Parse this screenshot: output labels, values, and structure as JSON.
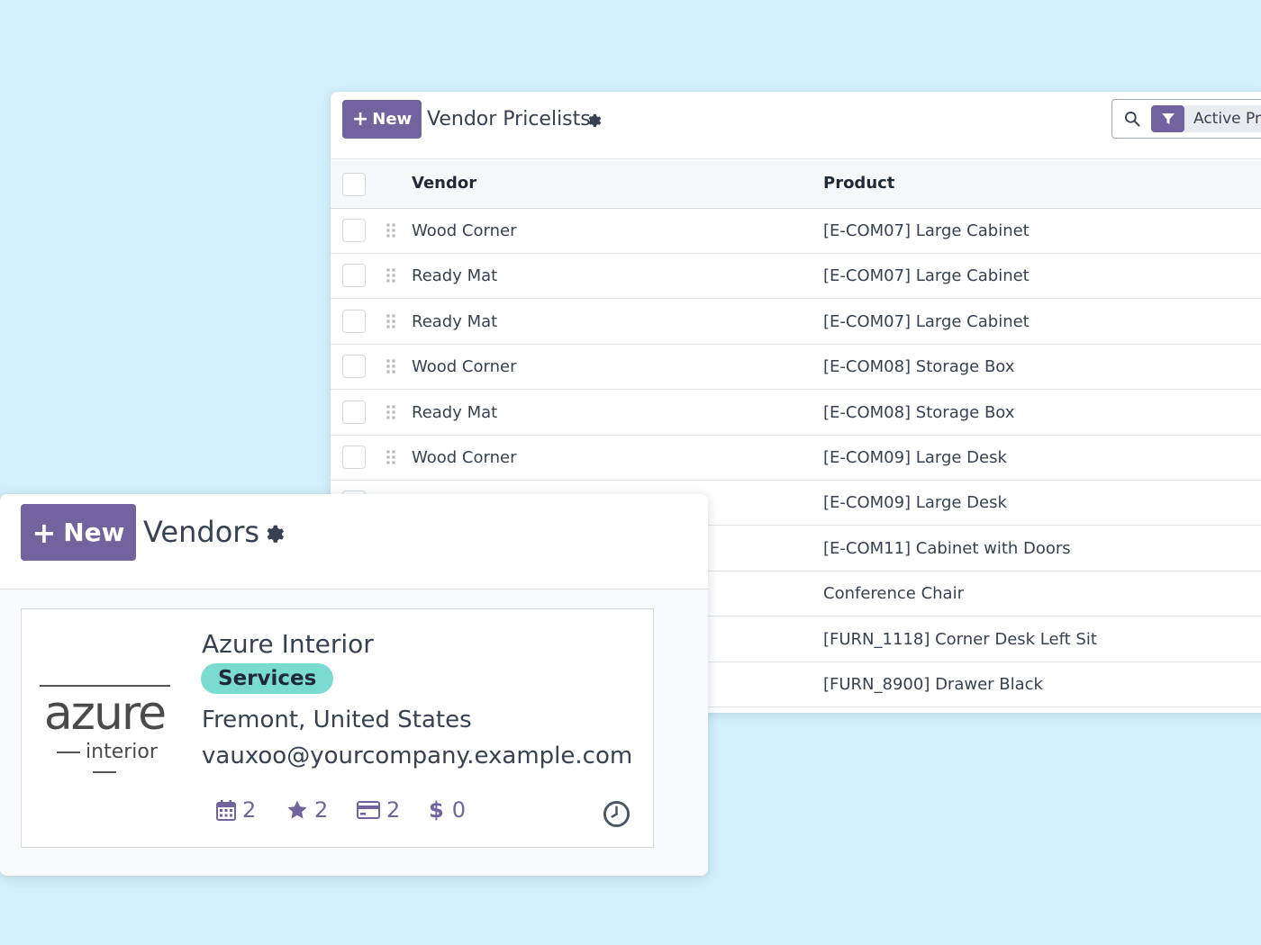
{
  "pricelist": {
    "new_label": "New",
    "title": "Vendor Pricelists",
    "facet": "Active Products",
    "columns": {
      "vendor": "Vendor",
      "product": "Product"
    },
    "rows": [
      {
        "vendor": "Wood Corner",
        "product": "[E-COM07] Large Cabinet"
      },
      {
        "vendor": "Ready Mat",
        "product": "[E-COM07] Large Cabinet"
      },
      {
        "vendor": "Ready Mat",
        "product": "[E-COM07] Large Cabinet"
      },
      {
        "vendor": "Wood Corner",
        "product": "[E-COM08] Storage Box"
      },
      {
        "vendor": "Ready Mat",
        "product": "[E-COM08] Storage Box"
      },
      {
        "vendor": "Wood Corner",
        "product": "[E-COM09] Large Desk"
      },
      {
        "vendor": "",
        "product": "[E-COM09] Large Desk"
      },
      {
        "vendor": "",
        "product": "[E-COM11] Cabinet with Doors"
      },
      {
        "vendor": "",
        "product": "Conference Chair"
      },
      {
        "vendor": "",
        "product": "[FURN_1118] Corner Desk Left Sit"
      },
      {
        "vendor": "",
        "product": "[FURN_8900] Drawer Black"
      }
    ]
  },
  "vendors": {
    "new_label": "New",
    "title": "Vendors",
    "card": {
      "logo_word": "azure",
      "logo_sub": "interior",
      "name": "Azure Interior",
      "tag": "Services",
      "location": "Fremont, United States",
      "email": "vauxoo@yourcompany.example.com",
      "stats": {
        "meetings": "2",
        "rating": "2",
        "cards": "2",
        "amount": "0"
      },
      "currency_symbol": "$"
    }
  },
  "colors": {
    "accent": "#71639e",
    "tag": "#7adcd0",
    "background": "#d3f0fb"
  },
  "icons": [
    "plus-icon",
    "gear-icon",
    "search-icon",
    "filter-icon",
    "drag-handle-icon",
    "calendar-icon",
    "star-icon",
    "credit-card-icon",
    "dollar-icon",
    "clock-icon"
  ]
}
